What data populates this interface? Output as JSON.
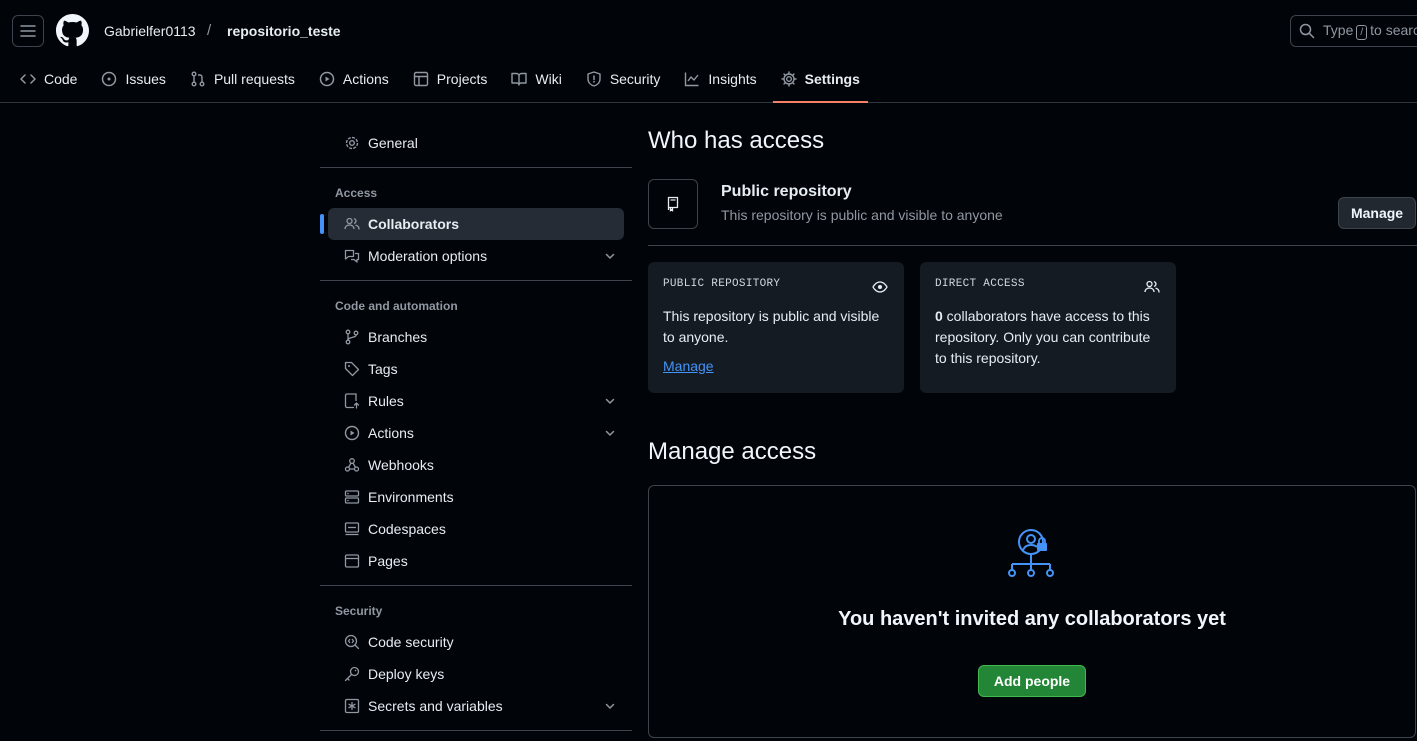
{
  "header": {
    "owner": "Gabrielfer0113",
    "separator": "/",
    "repo": "repositorio_teste",
    "search_prefix": "Type",
    "search_key": "/",
    "search_suffix": "to search"
  },
  "tabs": [
    {
      "label": "Code",
      "icon": "code-icon"
    },
    {
      "label": "Issues",
      "icon": "issue-icon"
    },
    {
      "label": "Pull requests",
      "icon": "pull-request-icon"
    },
    {
      "label": "Actions",
      "icon": "play-icon"
    },
    {
      "label": "Projects",
      "icon": "table-icon"
    },
    {
      "label": "Wiki",
      "icon": "book-icon"
    },
    {
      "label": "Security",
      "icon": "shield-icon"
    },
    {
      "label": "Insights",
      "icon": "graph-icon"
    },
    {
      "label": "Settings",
      "icon": "gear-icon",
      "selected": true
    }
  ],
  "sidebar": {
    "general": "General",
    "access_heading": "Access",
    "access_items": [
      "Collaborators",
      "Moderation options"
    ],
    "code_heading": "Code and automation",
    "code_items": [
      "Branches",
      "Tags",
      "Rules",
      "Actions",
      "Webhooks",
      "Environments",
      "Codespaces",
      "Pages"
    ],
    "security_heading": "Security",
    "security_items": [
      "Code security",
      "Deploy keys",
      "Secrets and variables"
    ]
  },
  "who_has_access": {
    "title": "Who has access",
    "repo_title": "Public repository",
    "repo_desc": "This repository is public and visible to anyone",
    "manage_button": "Manage",
    "public_card": {
      "label": "PUBLIC REPOSITORY",
      "text": "This repository is public and visible to anyone.",
      "link": "Manage"
    },
    "direct_card": {
      "label": "DIRECT ACCESS",
      "count": "0",
      "text": " collaborators have access to this repository. Only you can contribute to this repository."
    }
  },
  "manage_access": {
    "title": "Manage access",
    "empty_text": "You haven't invited any collaborators yet",
    "add_button": "Add people"
  },
  "colors": {
    "accent_tab": "#f78166",
    "link": "#4493f8",
    "primary_button": "#238636"
  }
}
